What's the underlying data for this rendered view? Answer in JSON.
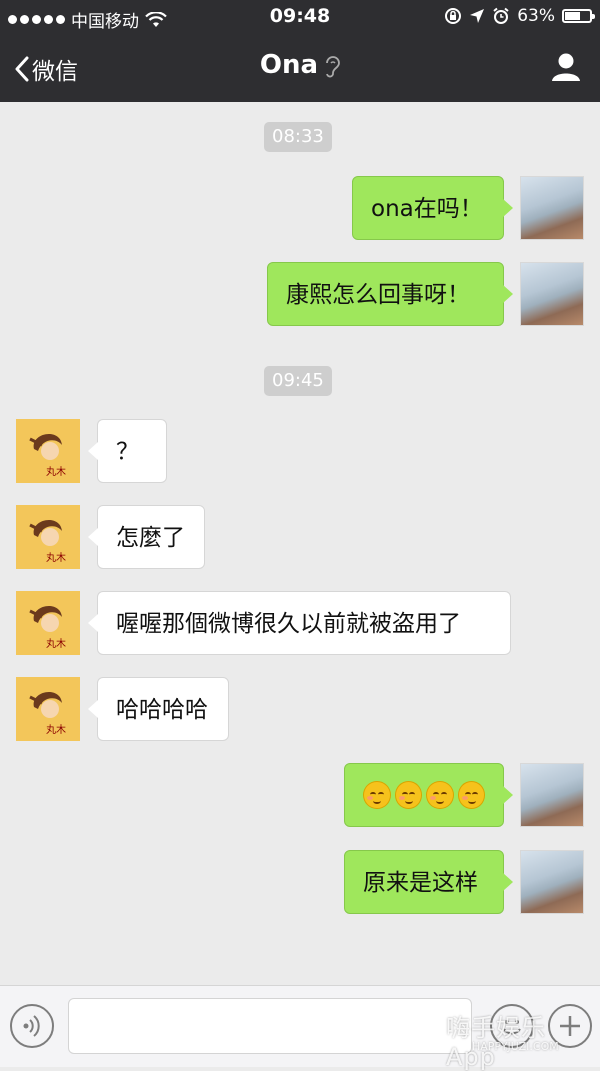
{
  "status_bar": {
    "carrier": "中国移动",
    "time": "09:48",
    "battery": "63%",
    "battery_level": 0.63,
    "icons": [
      "signal-dots-icon",
      "wifi-icon",
      "rotation-lock-icon",
      "location-arrow-icon",
      "alarm-icon",
      "battery-icon"
    ]
  },
  "nav": {
    "back_label": "微信",
    "title": "Ona",
    "icons": [
      "chevron-left-icon",
      "ear-icon",
      "profile-icon"
    ]
  },
  "timestamps": [
    "08:33",
    "09:45"
  ],
  "messages": [
    {
      "side": "me",
      "text": "ona在吗！"
    },
    {
      "side": "me",
      "text": "康熙怎么回事呀！"
    },
    {
      "side": "them",
      "text": "？"
    },
    {
      "side": "them",
      "text": "怎麼了"
    },
    {
      "side": "them",
      "text": "喔喔那個微博很久以前就被盗用了"
    },
    {
      "side": "them",
      "text": "哈哈哈哈"
    },
    {
      "side": "me",
      "emoji_count": 4,
      "emoji": "blushing-face"
    },
    {
      "side": "me",
      "text": "原来是这样"
    }
  ],
  "avatars": {
    "them_label": "丸木",
    "colors": {
      "them_bg": "#f3c65a",
      "me_bg": "#b6c6d4"
    }
  },
  "input_bar": {
    "icons": [
      "voice-icon",
      "emoji-icon",
      "plus-icon"
    ],
    "watermark": "嗨手娱乐 App",
    "watermark_sub": "HAPPYJUZI.COM"
  },
  "colors": {
    "header": "#2e2e31",
    "background": "#ebebeb",
    "bubble_me": "#9fe75c",
    "bubble_them": "#ffffff",
    "timestamp_bg": "#cecece"
  }
}
